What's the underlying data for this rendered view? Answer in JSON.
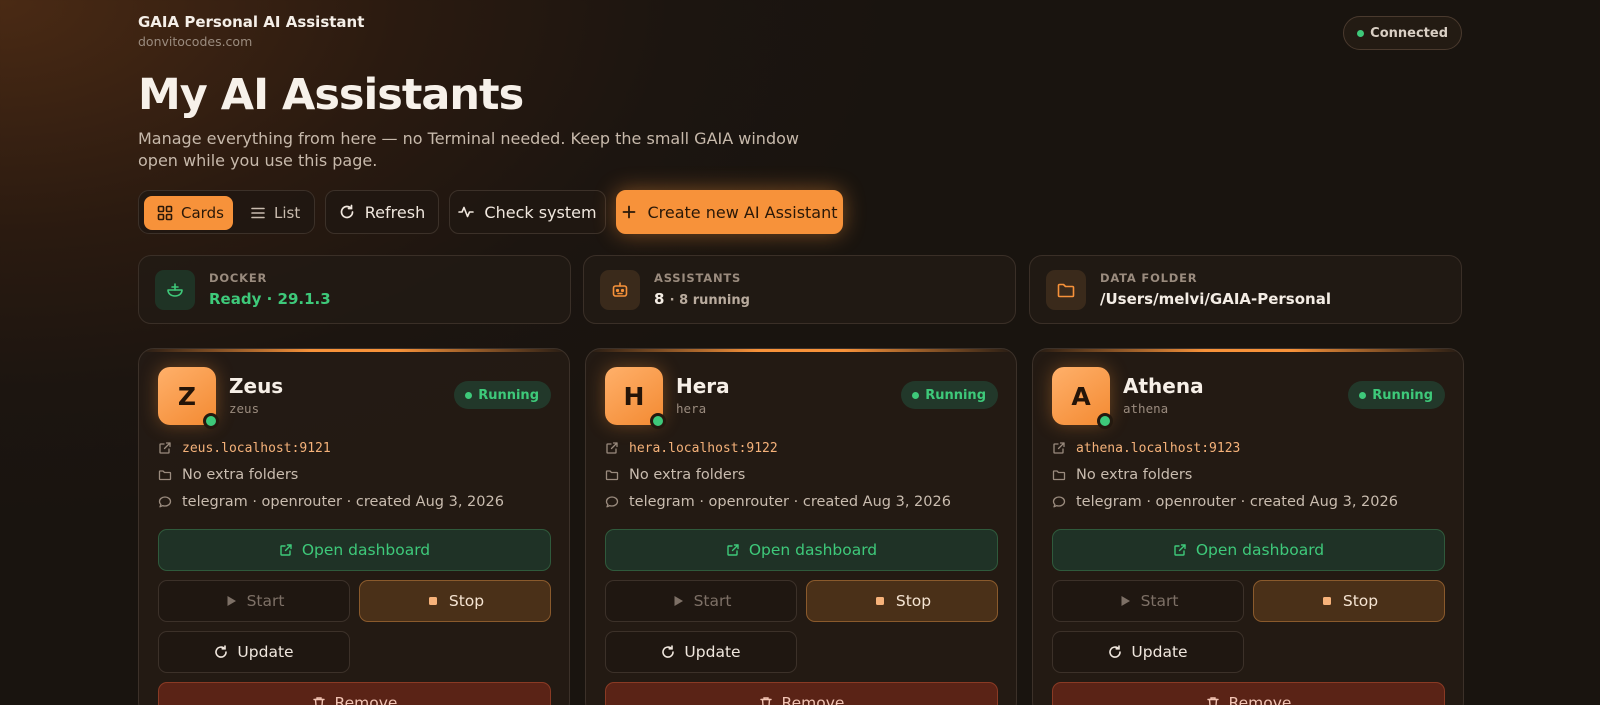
{
  "app": {
    "title": "GAIA Personal AI Assistant",
    "subtitle": "donvitocodes.com",
    "connection_status": "Connected"
  },
  "page": {
    "title": "My AI Assistants",
    "description": "Manage everything from here — no Terminal needed. Keep the small GAIA window open while you use this page."
  },
  "toolbar": {
    "view_toggle": {
      "cards_label": "Cards",
      "list_label": "List",
      "selected": "Cards"
    },
    "refresh_label": "Refresh",
    "check_system_label": "Check system",
    "create_label": "Create new AI Assistant"
  },
  "stats": {
    "docker": {
      "label": "DOCKER",
      "value": "Ready · 29.1.3"
    },
    "assistants": {
      "label": "ASSISTANTS",
      "count": "8",
      "detail": "· 8 running"
    },
    "data_folder": {
      "label": "DATA FOLDER",
      "value": "/Users/melvi/GAIA-Personal"
    }
  },
  "assistants": [
    {
      "initial": "Z",
      "name": "Zeus",
      "slug": "zeus",
      "status": "Running",
      "url": "zeus.localhost:9121",
      "folders": "No extra folders",
      "meta": "telegram · openrouter · created Aug 3, 2026"
    },
    {
      "initial": "H",
      "name": "Hera",
      "slug": "hera",
      "status": "Running",
      "url": "hera.localhost:9122",
      "folders": "No extra folders",
      "meta": "telegram · openrouter · created Aug 3, 2026"
    },
    {
      "initial": "A",
      "name": "Athena",
      "slug": "athena",
      "status": "Running",
      "url": "athena.localhost:9123",
      "folders": "No extra folders",
      "meta": "telegram · openrouter · created Aug 3, 2026"
    }
  ],
  "card_actions": {
    "open_dashboard": "Open dashboard",
    "start": "Start",
    "stop": "Stop",
    "update": "Update",
    "remove": "Remove"
  },
  "colors": {
    "accent": "#f7923a",
    "success": "#3ec97a",
    "danger": "#5a2316",
    "background": "#1c1510"
  },
  "icons": {
    "cards": "grid-icon",
    "list": "list-icon",
    "refresh": "refresh-icon",
    "check": "activity-icon",
    "create": "plus-icon",
    "docker": "docker-icon",
    "assistants": "robot-icon",
    "data_folder": "folder-icon",
    "url": "external-link-icon",
    "folders": "folder-icon",
    "meta": "chat-bubble-icon",
    "start": "play-icon",
    "stop": "stop-icon",
    "update": "refresh-icon",
    "remove": "trash-icon"
  }
}
